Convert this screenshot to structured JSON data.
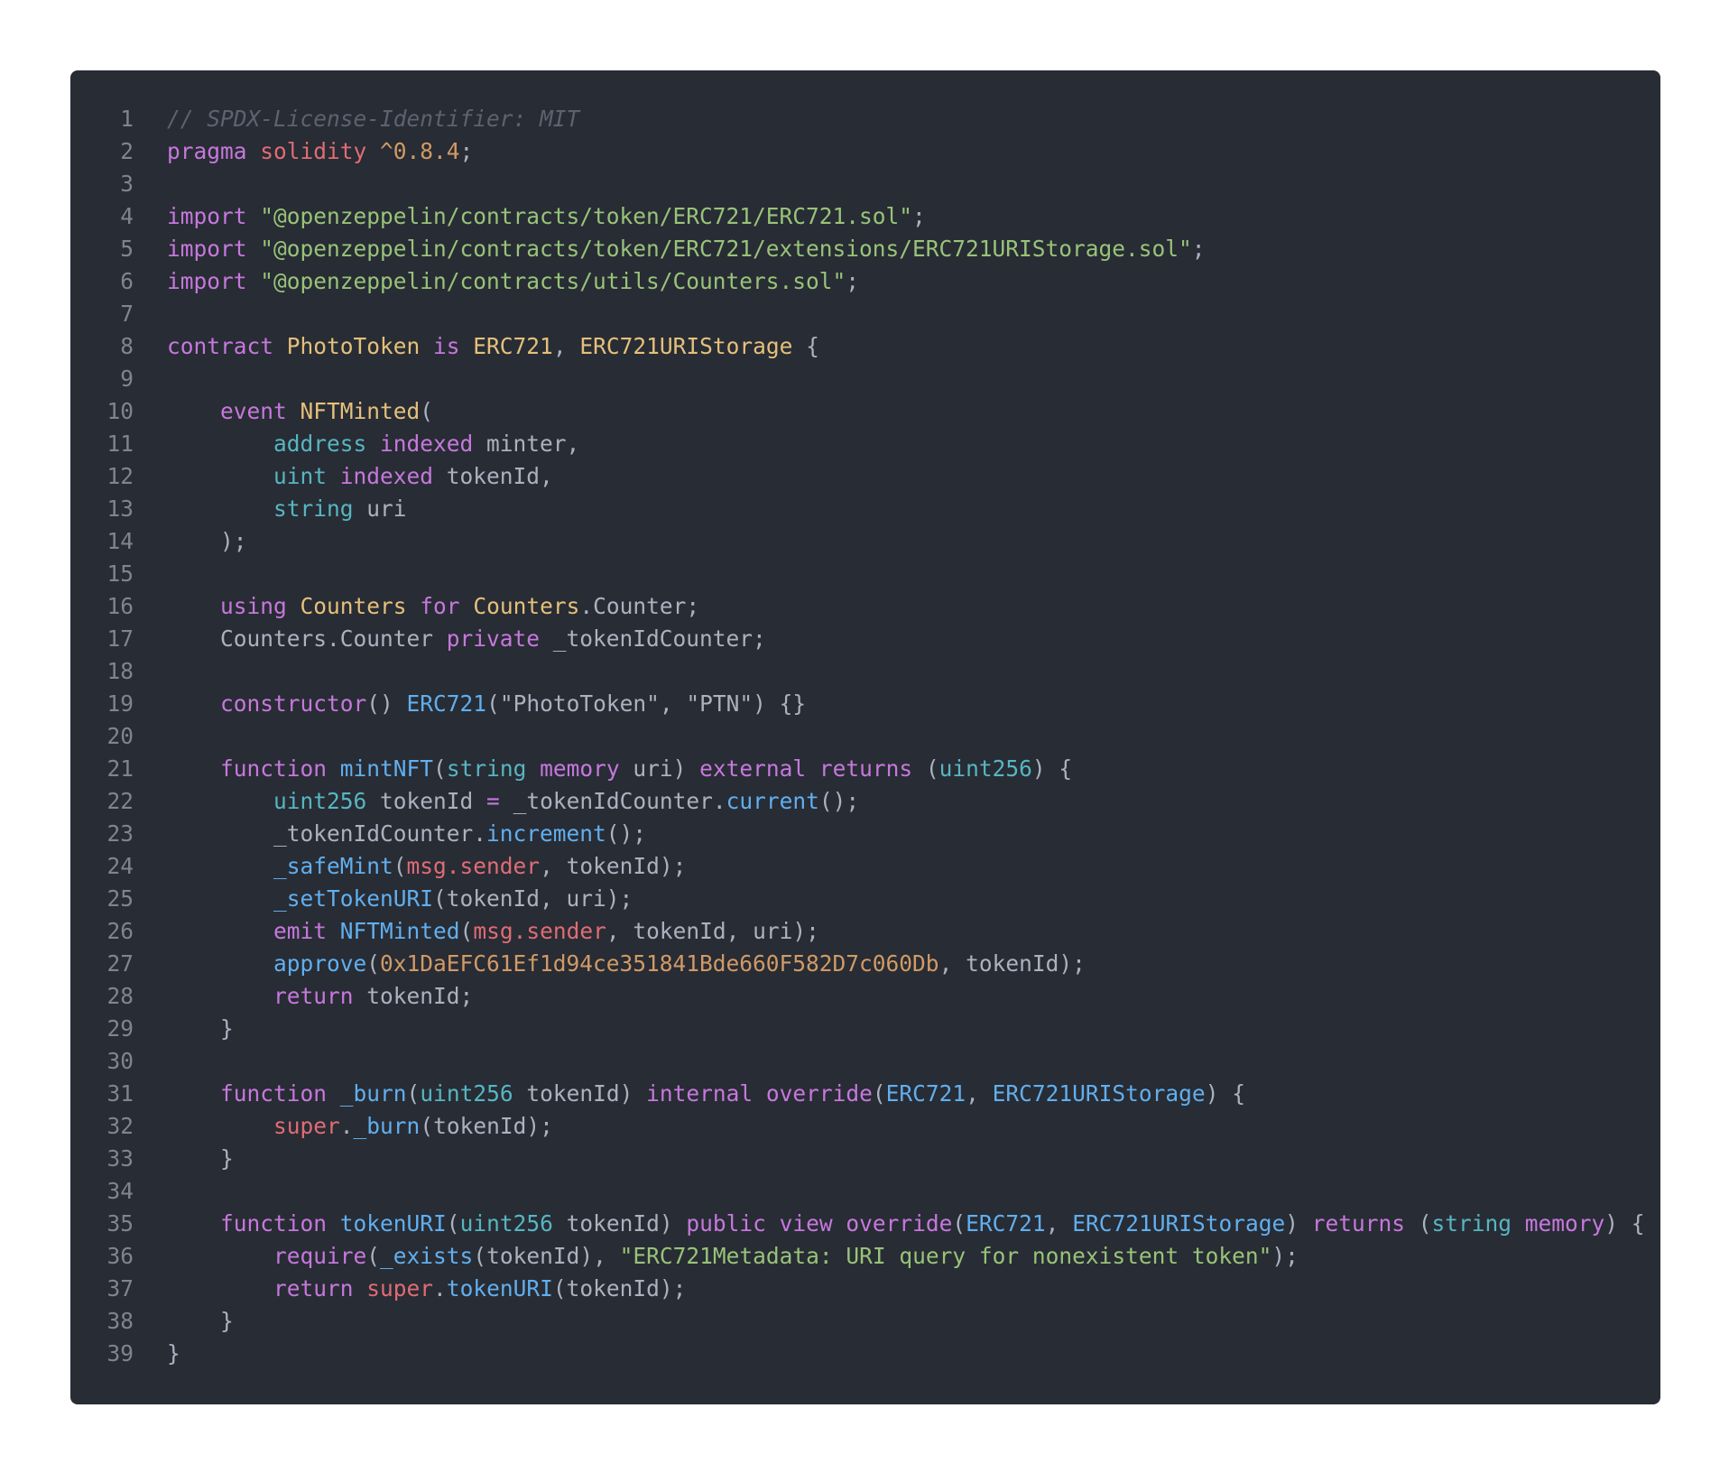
{
  "theme": {
    "background": "#282c34",
    "line_number": "#7f848e",
    "comment": "#5c6370",
    "keyword": "#c678dd",
    "type": "#56b6c2",
    "class": "#e5c07b",
    "function": "#61afef",
    "string": "#98c379",
    "number": "#d19a66",
    "variable": "#e06c75",
    "plain": "#abb2bf"
  },
  "code": {
    "language": "solidity",
    "lines": [
      {
        "n": "1",
        "tokens": [
          {
            "t": "// SPDX-License-Identifier: MIT",
            "k": "comment"
          }
        ]
      },
      {
        "n": "2",
        "tokens": [
          {
            "t": "pragma ",
            "k": "keyword"
          },
          {
            "t": "solidity ",
            "k": "var"
          },
          {
            "t": "^0.8.4",
            "k": "number"
          },
          {
            "t": ";",
            "k": "plain"
          }
        ]
      },
      {
        "n": "3",
        "tokens": []
      },
      {
        "n": "4",
        "tokens": [
          {
            "t": "import ",
            "k": "keyword"
          },
          {
            "t": "\"@openzeppelin/contracts/token/ERC721/ERC721.sol\"",
            "k": "string"
          },
          {
            "t": ";",
            "k": "plain"
          }
        ]
      },
      {
        "n": "5",
        "tokens": [
          {
            "t": "import ",
            "k": "keyword"
          },
          {
            "t": "\"@openzeppelin/contracts/token/ERC721/extensions/ERC721URIStorage.sol\"",
            "k": "string"
          },
          {
            "t": ";",
            "k": "plain"
          }
        ]
      },
      {
        "n": "6",
        "tokens": [
          {
            "t": "import ",
            "k": "keyword"
          },
          {
            "t": "\"@openzeppelin/contracts/utils/Counters.sol\"",
            "k": "string"
          },
          {
            "t": ";",
            "k": "plain"
          }
        ]
      },
      {
        "n": "7",
        "tokens": []
      },
      {
        "n": "8",
        "tokens": [
          {
            "t": "contract ",
            "k": "keyword"
          },
          {
            "t": "PhotoToken ",
            "k": "class"
          },
          {
            "t": "is ",
            "k": "keyword"
          },
          {
            "t": "ERC721",
            "k": "class"
          },
          {
            "t": ", ",
            "k": "plain"
          },
          {
            "t": "ERC721URIStorage",
            "k": "class"
          },
          {
            "t": " {",
            "k": "plain"
          }
        ]
      },
      {
        "n": "9",
        "tokens": []
      },
      {
        "n": "10",
        "tokens": [
          {
            "t": "    ",
            "k": "plain"
          },
          {
            "t": "event ",
            "k": "keyword"
          },
          {
            "t": "NFTMinted",
            "k": "class"
          },
          {
            "t": "(",
            "k": "plain"
          }
        ]
      },
      {
        "n": "11",
        "tokens": [
          {
            "t": "        ",
            "k": "plain"
          },
          {
            "t": "address ",
            "k": "type"
          },
          {
            "t": "indexed ",
            "k": "keyword"
          },
          {
            "t": "minter,",
            "k": "plain"
          }
        ]
      },
      {
        "n": "12",
        "tokens": [
          {
            "t": "        ",
            "k": "plain"
          },
          {
            "t": "uint ",
            "k": "type"
          },
          {
            "t": "indexed ",
            "k": "keyword"
          },
          {
            "t": "tokenId,",
            "k": "plain"
          }
        ]
      },
      {
        "n": "13",
        "tokens": [
          {
            "t": "        ",
            "k": "plain"
          },
          {
            "t": "string ",
            "k": "type"
          },
          {
            "t": "uri",
            "k": "plain"
          }
        ]
      },
      {
        "n": "14",
        "tokens": [
          {
            "t": "    );",
            "k": "plain"
          }
        ]
      },
      {
        "n": "15",
        "tokens": []
      },
      {
        "n": "16",
        "tokens": [
          {
            "t": "    ",
            "k": "plain"
          },
          {
            "t": "using ",
            "k": "keyword"
          },
          {
            "t": "Counters ",
            "k": "class"
          },
          {
            "t": "for ",
            "k": "keyword"
          },
          {
            "t": "Counters",
            "k": "class"
          },
          {
            "t": ".Counter;",
            "k": "plain"
          }
        ]
      },
      {
        "n": "17",
        "tokens": [
          {
            "t": "    Counters.Counter ",
            "k": "plain"
          },
          {
            "t": "private ",
            "k": "keyword"
          },
          {
            "t": "_tokenIdCounter;",
            "k": "plain"
          }
        ]
      },
      {
        "n": "18",
        "tokens": []
      },
      {
        "n": "19",
        "tokens": [
          {
            "t": "    ",
            "k": "plain"
          },
          {
            "t": "constructor",
            "k": "keyword"
          },
          {
            "t": "() ",
            "k": "plain"
          },
          {
            "t": "ERC721",
            "k": "func"
          },
          {
            "t": "(\"PhotoToken\", \"PTN\") {}",
            "k": "plain"
          }
        ]
      },
      {
        "n": "20",
        "tokens": []
      },
      {
        "n": "21",
        "tokens": [
          {
            "t": "    ",
            "k": "plain"
          },
          {
            "t": "function ",
            "k": "keyword"
          },
          {
            "t": "mintNFT",
            "k": "func"
          },
          {
            "t": "(",
            "k": "plain"
          },
          {
            "t": "string ",
            "k": "type"
          },
          {
            "t": "memory ",
            "k": "keyword"
          },
          {
            "t": "uri) ",
            "k": "plain"
          },
          {
            "t": "external ",
            "k": "keyword"
          },
          {
            "t": "returns ",
            "k": "keyword"
          },
          {
            "t": "(",
            "k": "plain"
          },
          {
            "t": "uint256",
            "k": "type"
          },
          {
            "t": ") {",
            "k": "plain"
          }
        ]
      },
      {
        "n": "22",
        "tokens": [
          {
            "t": "        ",
            "k": "plain"
          },
          {
            "t": "uint256 ",
            "k": "type"
          },
          {
            "t": "tokenId ",
            "k": "plain"
          },
          {
            "t": "= ",
            "k": "keyword"
          },
          {
            "t": "_tokenIdCounter.",
            "k": "plain"
          },
          {
            "t": "current",
            "k": "func"
          },
          {
            "t": "();",
            "k": "plain"
          }
        ]
      },
      {
        "n": "23",
        "tokens": [
          {
            "t": "        _tokenIdCounter.",
            "k": "plain"
          },
          {
            "t": "increment",
            "k": "func"
          },
          {
            "t": "();",
            "k": "plain"
          }
        ]
      },
      {
        "n": "24",
        "tokens": [
          {
            "t": "        ",
            "k": "plain"
          },
          {
            "t": "_safeMint",
            "k": "func"
          },
          {
            "t": "(",
            "k": "plain"
          },
          {
            "t": "msg.sender",
            "k": "var"
          },
          {
            "t": ", tokenId);",
            "k": "plain"
          }
        ]
      },
      {
        "n": "25",
        "tokens": [
          {
            "t": "        ",
            "k": "plain"
          },
          {
            "t": "_setTokenURI",
            "k": "func"
          },
          {
            "t": "(tokenId, uri);",
            "k": "plain"
          }
        ]
      },
      {
        "n": "26",
        "tokens": [
          {
            "t": "        ",
            "k": "plain"
          },
          {
            "t": "emit ",
            "k": "keyword"
          },
          {
            "t": "NFTMinted",
            "k": "func"
          },
          {
            "t": "(",
            "k": "plain"
          },
          {
            "t": "msg.sender",
            "k": "var"
          },
          {
            "t": ", tokenId, uri);",
            "k": "plain"
          }
        ]
      },
      {
        "n": "27",
        "tokens": [
          {
            "t": "        ",
            "k": "plain"
          },
          {
            "t": "approve",
            "k": "func"
          },
          {
            "t": "(",
            "k": "plain"
          },
          {
            "t": "0x1DaEFC61Ef1d94ce351841Bde660F582D7c060Db",
            "k": "number"
          },
          {
            "t": ", tokenId);",
            "k": "plain"
          }
        ]
      },
      {
        "n": "28",
        "tokens": [
          {
            "t": "        ",
            "k": "plain"
          },
          {
            "t": "return ",
            "k": "keyword"
          },
          {
            "t": "tokenId;",
            "k": "plain"
          }
        ]
      },
      {
        "n": "29",
        "tokens": [
          {
            "t": "    }",
            "k": "plain"
          }
        ]
      },
      {
        "n": "30",
        "tokens": []
      },
      {
        "n": "31",
        "tokens": [
          {
            "t": "    ",
            "k": "plain"
          },
          {
            "t": "function ",
            "k": "keyword"
          },
          {
            "t": "_burn",
            "k": "func"
          },
          {
            "t": "(",
            "k": "plain"
          },
          {
            "t": "uint256 ",
            "k": "type"
          },
          {
            "t": "tokenId) ",
            "k": "plain"
          },
          {
            "t": "internal ",
            "k": "keyword"
          },
          {
            "t": "override",
            "k": "keyword"
          },
          {
            "t": "(",
            "k": "plain"
          },
          {
            "t": "ERC721",
            "k": "func"
          },
          {
            "t": ", ",
            "k": "plain"
          },
          {
            "t": "ERC721URIStorage",
            "k": "func"
          },
          {
            "t": ") {",
            "k": "plain"
          }
        ]
      },
      {
        "n": "32",
        "tokens": [
          {
            "t": "        ",
            "k": "plain"
          },
          {
            "t": "super",
            "k": "var"
          },
          {
            "t": ".",
            "k": "plain"
          },
          {
            "t": "_burn",
            "k": "func"
          },
          {
            "t": "(tokenId);",
            "k": "plain"
          }
        ]
      },
      {
        "n": "33",
        "tokens": [
          {
            "t": "    }",
            "k": "plain"
          }
        ]
      },
      {
        "n": "34",
        "tokens": []
      },
      {
        "n": "35",
        "tokens": [
          {
            "t": "    ",
            "k": "plain"
          },
          {
            "t": "function ",
            "k": "keyword"
          },
          {
            "t": "tokenURI",
            "k": "func"
          },
          {
            "t": "(",
            "k": "plain"
          },
          {
            "t": "uint256 ",
            "k": "type"
          },
          {
            "t": "tokenId) ",
            "k": "plain"
          },
          {
            "t": "public ",
            "k": "keyword"
          },
          {
            "t": "view ",
            "k": "keyword"
          },
          {
            "t": "override",
            "k": "keyword"
          },
          {
            "t": "(",
            "k": "plain"
          },
          {
            "t": "ERC721",
            "k": "func"
          },
          {
            "t": ", ",
            "k": "plain"
          },
          {
            "t": "ERC721URIStorage",
            "k": "func"
          },
          {
            "t": ") ",
            "k": "plain"
          },
          {
            "t": "returns ",
            "k": "keyword"
          },
          {
            "t": "(",
            "k": "plain"
          },
          {
            "t": "string ",
            "k": "type"
          },
          {
            "t": "memory",
            "k": "keyword"
          },
          {
            "t": ") {",
            "k": "plain"
          }
        ]
      },
      {
        "n": "36",
        "tokens": [
          {
            "t": "        ",
            "k": "plain"
          },
          {
            "t": "require",
            "k": "keyword"
          },
          {
            "t": "(",
            "k": "plain"
          },
          {
            "t": "_exists",
            "k": "func"
          },
          {
            "t": "(tokenId), ",
            "k": "plain"
          },
          {
            "t": "\"ERC721Metadata: URI query for nonexistent token\"",
            "k": "string"
          },
          {
            "t": ");",
            "k": "plain"
          }
        ]
      },
      {
        "n": "37",
        "tokens": [
          {
            "t": "        ",
            "k": "plain"
          },
          {
            "t": "return ",
            "k": "keyword"
          },
          {
            "t": "super",
            "k": "var"
          },
          {
            "t": ".",
            "k": "plain"
          },
          {
            "t": "tokenURI",
            "k": "func"
          },
          {
            "t": "(tokenId);",
            "k": "plain"
          }
        ]
      },
      {
        "n": "38",
        "tokens": [
          {
            "t": "    }",
            "k": "plain"
          }
        ]
      },
      {
        "n": "39",
        "tokens": [
          {
            "t": "}",
            "k": "plain"
          }
        ]
      }
    ]
  }
}
